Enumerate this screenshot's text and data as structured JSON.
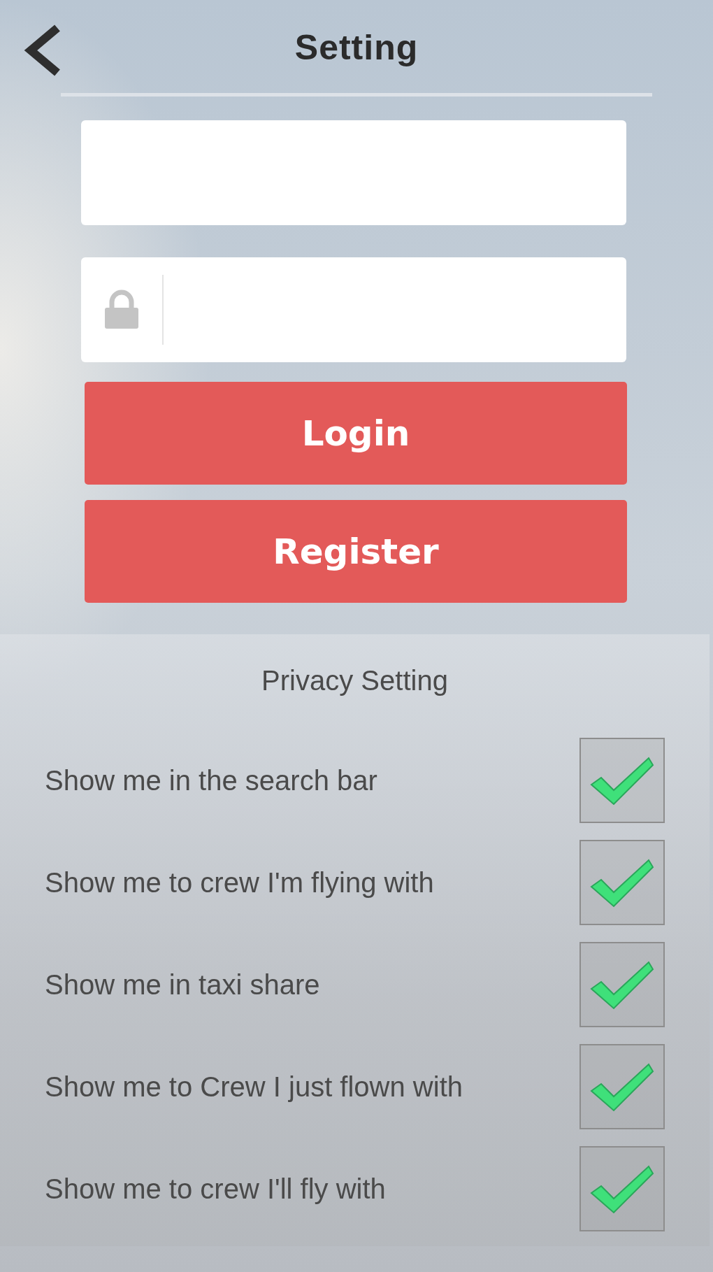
{
  "header": {
    "title": "Setting"
  },
  "fields": [
    {
      "kind": "text"
    },
    {
      "kind": "password"
    }
  ],
  "buttons": [
    {
      "label": "Login"
    },
    {
      "label": "Register"
    }
  ],
  "privacy": {
    "title": "Privacy Setting",
    "options": [
      {
        "label": "Show me in the search bar",
        "checked": true
      },
      {
        "label": "Show me to crew I'm flying with",
        "checked": true
      },
      {
        "label": "Show me in taxi share",
        "checked": true
      },
      {
        "label": "Show me to Crew I just flown with",
        "checked": true
      },
      {
        "label": "Show me to crew I'll fly with",
        "checked": true
      }
    ]
  }
}
